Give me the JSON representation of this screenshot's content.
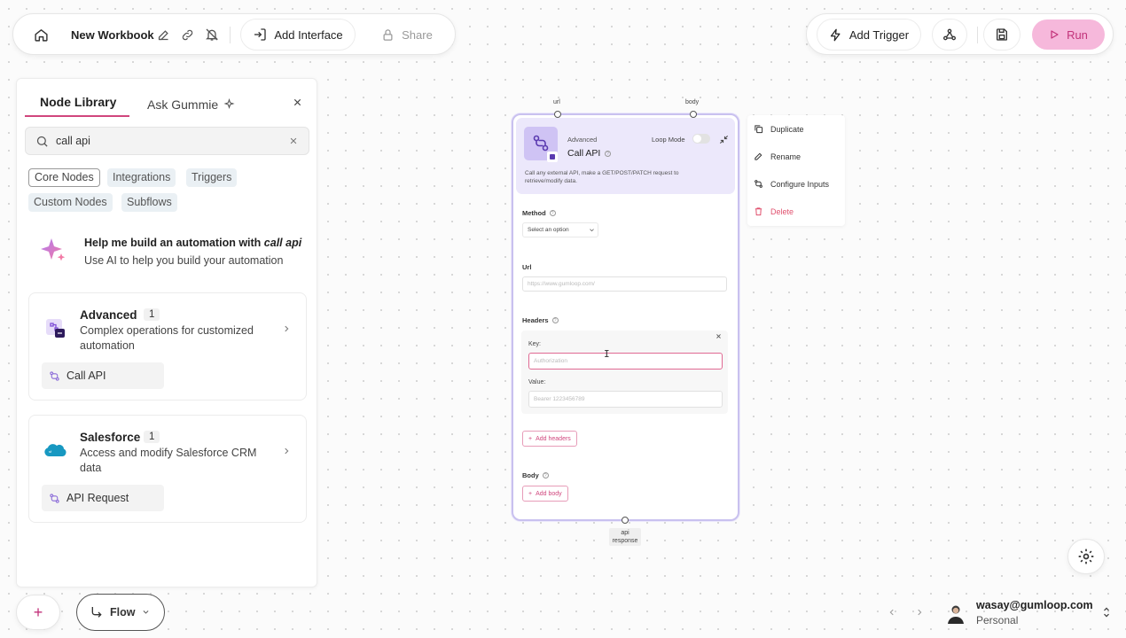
{
  "toolbar": {
    "workbook_name": "New Workbook",
    "add_interface": "Add Interface",
    "share": "Share",
    "add_trigger": "Add Trigger",
    "run": "Run"
  },
  "library": {
    "tabs": [
      "Node Library",
      "Ask Gummie"
    ],
    "active_tab": "Node Library",
    "search_value": "call api",
    "filters": [
      "Core Nodes",
      "Integrations",
      "Triggers",
      "Custom Nodes",
      "Subflows"
    ],
    "active_filter": "Core Nodes",
    "ai_help": {
      "title_prefix": "Help me build an automation with ",
      "title_query": "call api",
      "subtitle": "Use AI to help you build your automation"
    },
    "cards": [
      {
        "title": "Advanced",
        "count": "1",
        "description": "Complex operations for customized automation",
        "item": "Call API"
      },
      {
        "title": "Salesforce",
        "count": "1",
        "description": "Access and modify Salesforce CRM data",
        "item": "API Request"
      }
    ]
  },
  "node": {
    "inputs": [
      "url",
      "body"
    ],
    "output": "api response",
    "category": "Advanced",
    "title": "Call API",
    "loop_mode_label": "Loop Mode",
    "description": "Call any external API, make a GET/POST/PATCH request to retrieve/modify data.",
    "method_label": "Method",
    "method_value": "Select an option",
    "url_label": "Url",
    "url_placeholder": "https://www.gumloop.com/",
    "headers_label": "Headers",
    "key_label": "Key:",
    "key_placeholder": "Authorization",
    "value_label": "Value:",
    "value_placeholder": "Bearer 1223456789",
    "add_headers": "Add headers",
    "body_label": "Body",
    "add_body": "Add body"
  },
  "context_menu": [
    "Duplicate",
    "Rename",
    "Configure Inputs",
    "Delete"
  ],
  "bottom": {
    "flow_label": "Flow",
    "user_email": "wasay@gumloop.com",
    "user_plan": "Personal"
  },
  "colors": {
    "accent_pink": "#d0467d",
    "run_bg": "#f6b8db",
    "node_header_bg": "#ece8fb",
    "delete_red": "#e0516e"
  }
}
